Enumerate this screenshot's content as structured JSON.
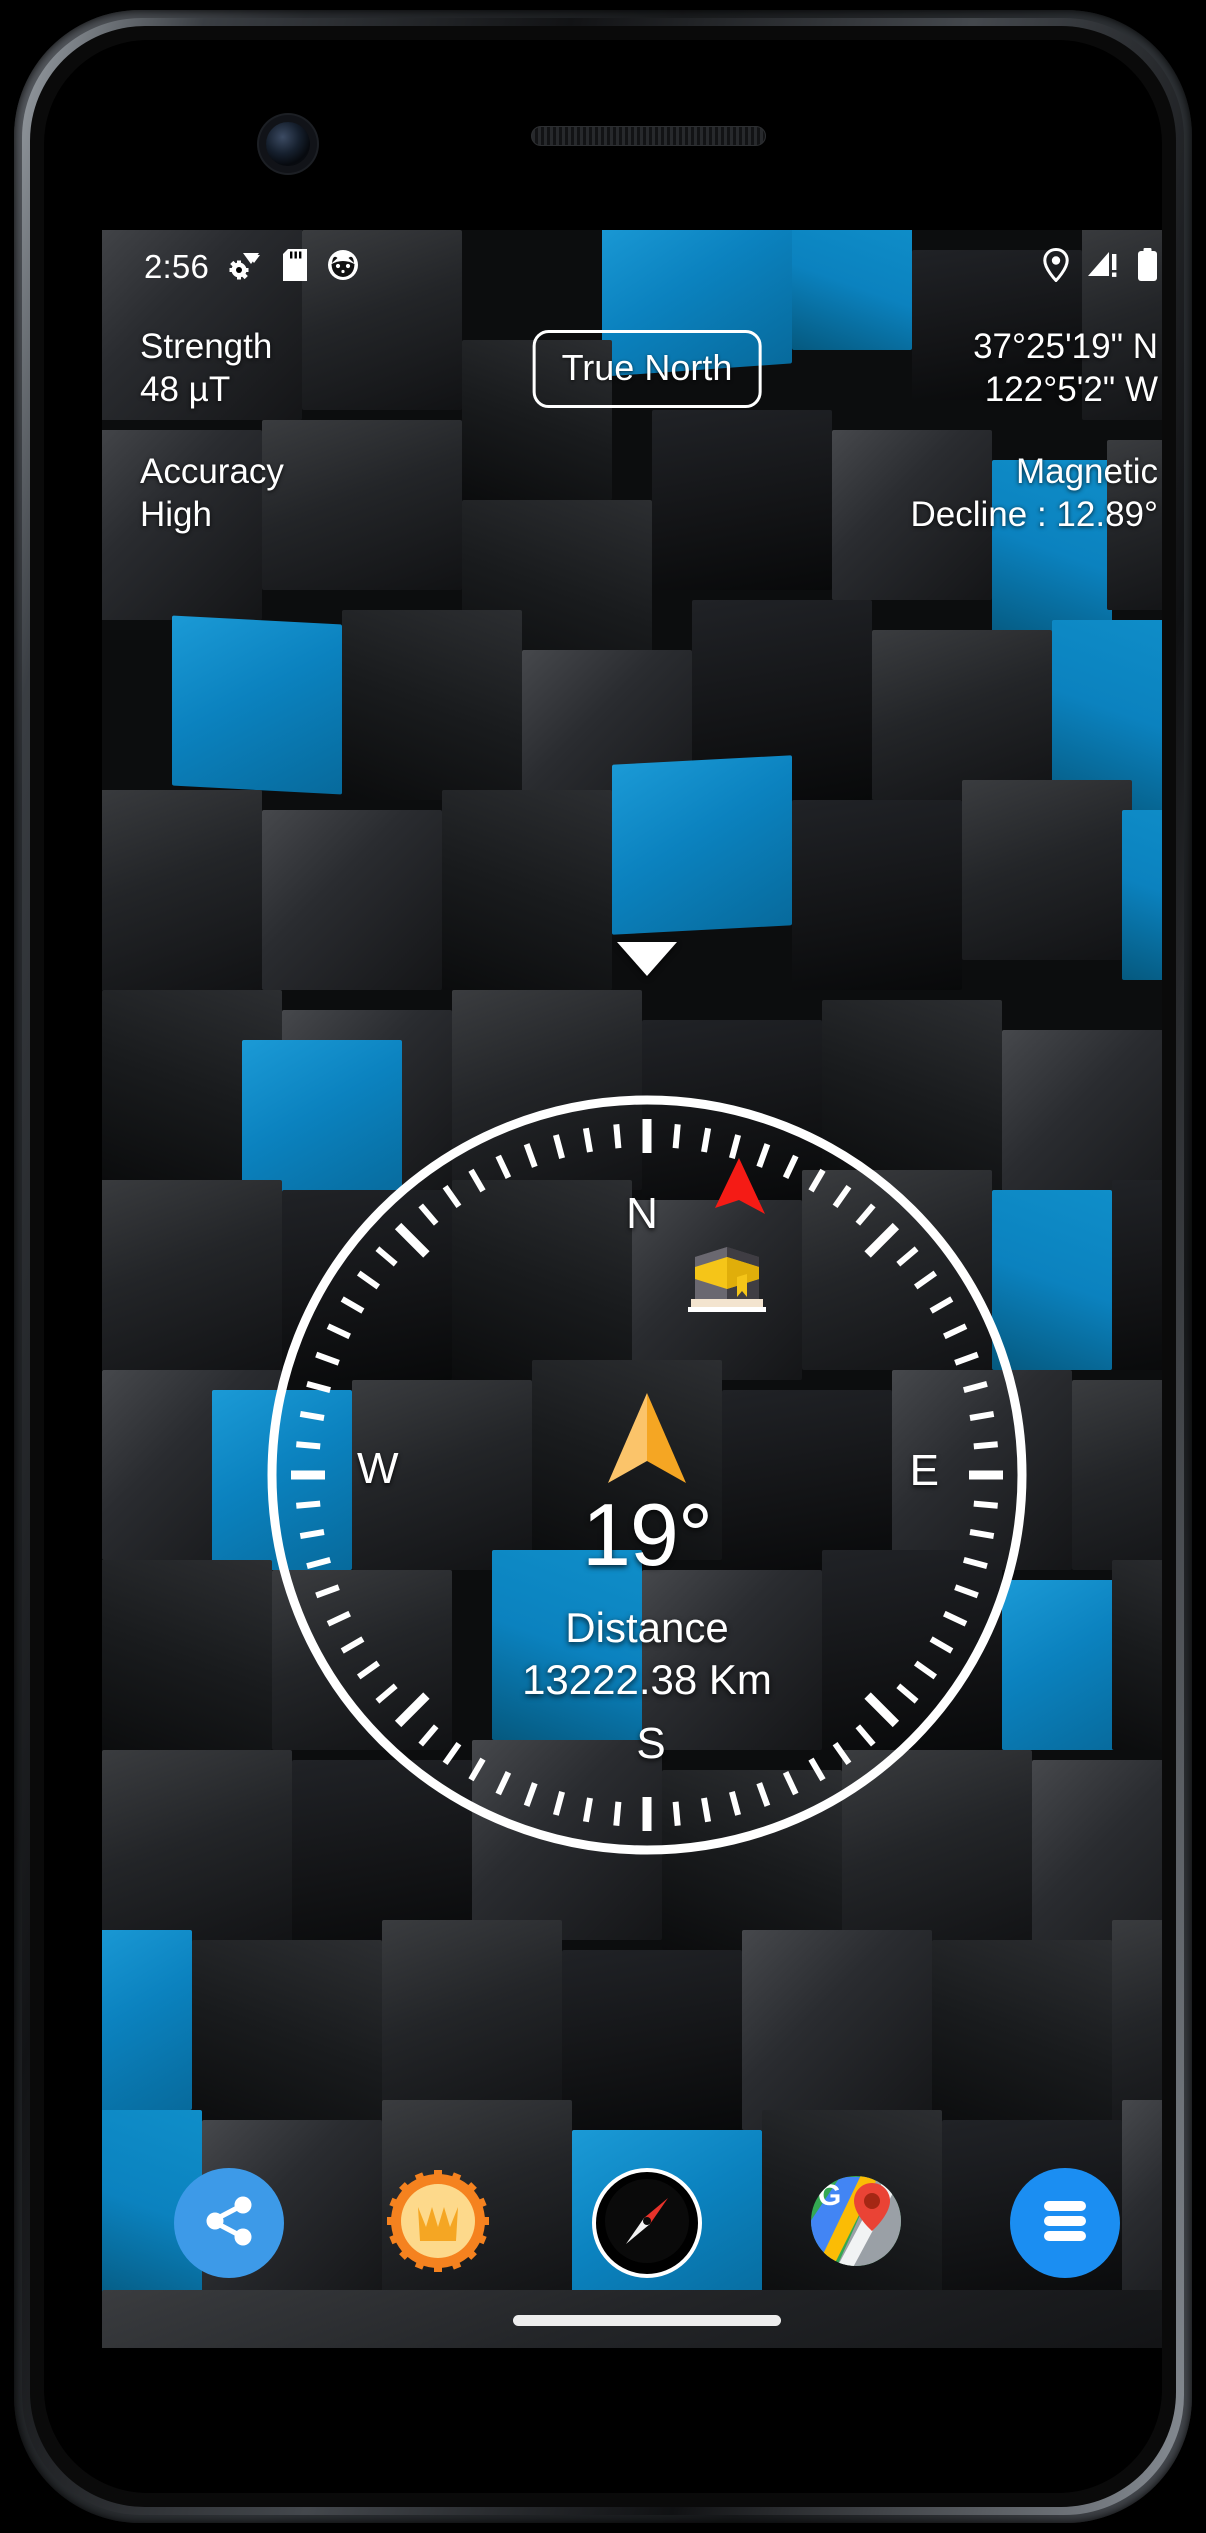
{
  "device": {
    "camera_icon": "front-camera",
    "speaker_icon": "earpiece-speaker",
    "home_indicator": "gesture-home-bar"
  },
  "status_bar": {
    "clock": "2:56",
    "left_icons": [
      {
        "name": "wifi-settings-icon",
        "glyph": "wifi-gear"
      },
      {
        "name": "sd-card-icon",
        "glyph": "sd-card"
      },
      {
        "name": "cat-face-icon",
        "glyph": "cat-face"
      }
    ],
    "right_icons": [
      {
        "name": "location-pin-icon",
        "glyph": "location-pin"
      },
      {
        "name": "no-signal-icon",
        "glyph": "signal-alert"
      },
      {
        "name": "battery-icon",
        "glyph": "battery-full"
      }
    ]
  },
  "top_info": {
    "strength_label": "Strength",
    "strength_value": "48 µT",
    "accuracy_label": "Accuracy",
    "accuracy_value": "High",
    "latitude": "37°25'19\" N",
    "longitude": "122°5'2\" W",
    "magnetic_label": "Magnetic",
    "magnetic_decline": "Decline : 12.89°"
  },
  "north_mode_button": {
    "label": "True North"
  },
  "compass": {
    "cardinals": {
      "n": "N",
      "e": "E",
      "s": "S",
      "w": "W"
    },
    "bearing": "19°",
    "distance_label": "Distance",
    "distance_value": "13222.38 Km",
    "qibla_marker_icon": "red-qibla-arrow",
    "kaaba_icon": "kaaba-icon",
    "needle_icon": "orange-direction-needle",
    "dial_pointer_icon": "white-triangle-pointer",
    "ring_color": "#ffffff",
    "needle_color": "#f5a623",
    "marker_color": "#f51b15",
    "qibla_marker_angle_deg": 19
  },
  "bottom_nav": [
    {
      "name": "nav-share",
      "icon": "share-icon",
      "color": "#3d9ae8"
    },
    {
      "name": "nav-premium",
      "icon": "crown-badge-icon",
      "color": "#f59a16"
    },
    {
      "name": "nav-compass",
      "icon": "compass-icon",
      "color": "#000000"
    },
    {
      "name": "nav-maps",
      "icon": "google-maps-icon",
      "color": "#34a853"
    },
    {
      "name": "nav-menu",
      "icon": "hamburger-menu-icon",
      "color": "#1b8ef2"
    }
  ],
  "theme": {
    "accent_blue": "#0b82bf",
    "background": "#0c0d0e",
    "text": "#ffffff"
  }
}
